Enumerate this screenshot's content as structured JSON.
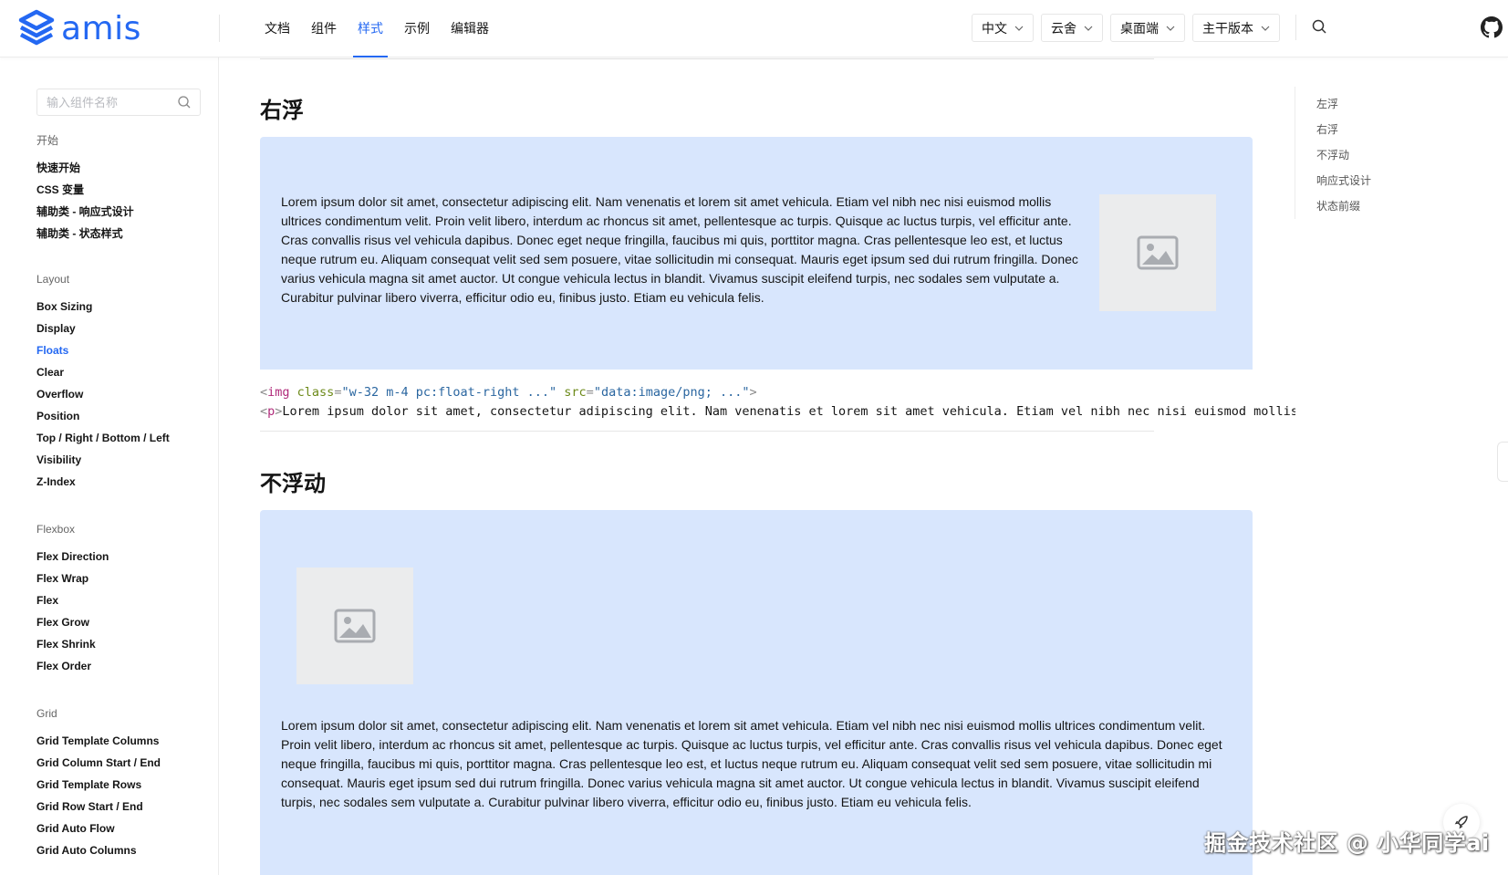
{
  "header": {
    "logo_text": "amis",
    "nav": [
      {
        "label": "文档",
        "active": false
      },
      {
        "label": "组件",
        "active": false
      },
      {
        "label": "样式",
        "active": true
      },
      {
        "label": "示例",
        "active": false
      },
      {
        "label": "编辑器",
        "active": false
      }
    ],
    "selects": [
      "中文",
      "云舍",
      "桌面端",
      "主干版本"
    ],
    "accent_color": "#2468f2"
  },
  "sidebar": {
    "search_placeholder": "输入组件名称",
    "groups": [
      {
        "title": "开始",
        "items": [
          "快速开始",
          "CSS 变量",
          "辅助类 - 响应式设计",
          "辅助类 - 状态样式"
        ]
      },
      {
        "title": "Layout",
        "items": [
          "Box Sizing",
          "Display",
          "Floats",
          "Clear",
          "Overflow",
          "Position",
          "Top / Right / Bottom / Left",
          "Visibility",
          "Z-Index"
        ]
      },
      {
        "title": "Flexbox",
        "items": [
          "Flex Direction",
          "Flex Wrap",
          "Flex",
          "Flex Grow",
          "Flex Shrink",
          "Flex Order"
        ]
      },
      {
        "title": "Grid",
        "items": [
          "Grid Template Columns",
          "Grid Column Start / End",
          "Grid Template Rows",
          "Grid Row Start / End",
          "Grid Auto Flow",
          "Grid Auto Columns"
        ]
      }
    ],
    "active_item": "Floats"
  },
  "main": {
    "section1_title": "右浮",
    "section1_text": "Lorem ipsum dolor sit amet, consectetur adipiscing elit. Nam venenatis et lorem sit amet vehicula. Etiam vel nibh nec nisi euismod mollis ultrices condimentum velit. Proin velit libero, interdum ac rhoncus sit amet, pellentesque ac turpis. Quisque ac luctus turpis, vel efficitur ante. Cras convallis risus vel vehicula dapibus. Donec eget neque fringilla, faucibus mi quis, porttitor magna. Cras pellentesque leo est, et luctus neque rutrum eu. Aliquam consequat velit sed sem posuere, vitae sollicitudin mi consequat. Mauris eget ipsum sed dui rutrum fringilla. Donec varius vehicula magna sit amet auctor. Ut congue vehicula lectus in blandit. Vivamus suscipit eleifend turpis, nec sodales sem vulputate a. Curabitur pulvinar libero viverra, efficitur odio eu, finibus justo. Etiam eu vehicula felis.",
    "code_line1": {
      "open": "<",
      "tag": "img",
      "attr1": " class",
      "eq1": "=",
      "val1": "\"w-32 m-4 pc:float-right ...\"",
      "attr2": " src",
      "eq2": "=",
      "val2": "\"data:image/png; ...\"",
      "close": ">"
    },
    "code_line2": {
      "open": "<",
      "tag": "p",
      "close": ">",
      "text": "Lorem ipsum dolor sit amet, consectetur adipiscing elit. Nam venenatis et lorem sit amet vehicula. Etiam vel nibh nec nisi euismod mollis ultrices condimentum velit."
    },
    "section2_title": "不浮动",
    "section2_text": "Lorem ipsum dolor sit amet, consectetur adipiscing elit. Nam venenatis et lorem sit amet vehicula. Etiam vel nibh nec nisi euismod mollis ultrices condimentum velit. Proin velit libero, interdum ac rhoncus sit amet, pellentesque ac turpis. Quisque ac luctus turpis, vel efficitur ante. Cras convallis risus vel vehicula dapibus. Donec eget neque fringilla, faucibus mi quis, porttitor magna. Cras pellentesque leo est, et luctus neque rutrum eu. Aliquam consequat velit sed sem posuere, vitae sollicitudin mi consequat. Mauris eget ipsum sed dui rutrum fringilla. Donec varius vehicula magna sit amet auctor. Ut congue vehicula lectus in blandit. Vivamus suscipit eleifend turpis, nec sodales sem vulputate a. Curabitur pulvinar libero viverra, efficitur odio eu, finibus justo. Etiam eu vehicula felis.",
    "demo_bg": "#d8e6fd"
  },
  "toc": [
    "左浮",
    "右浮",
    "不浮动",
    "响应式设计",
    "状态前缀"
  ],
  "watermark": "掘金技术社区 @ 小华同学ai"
}
